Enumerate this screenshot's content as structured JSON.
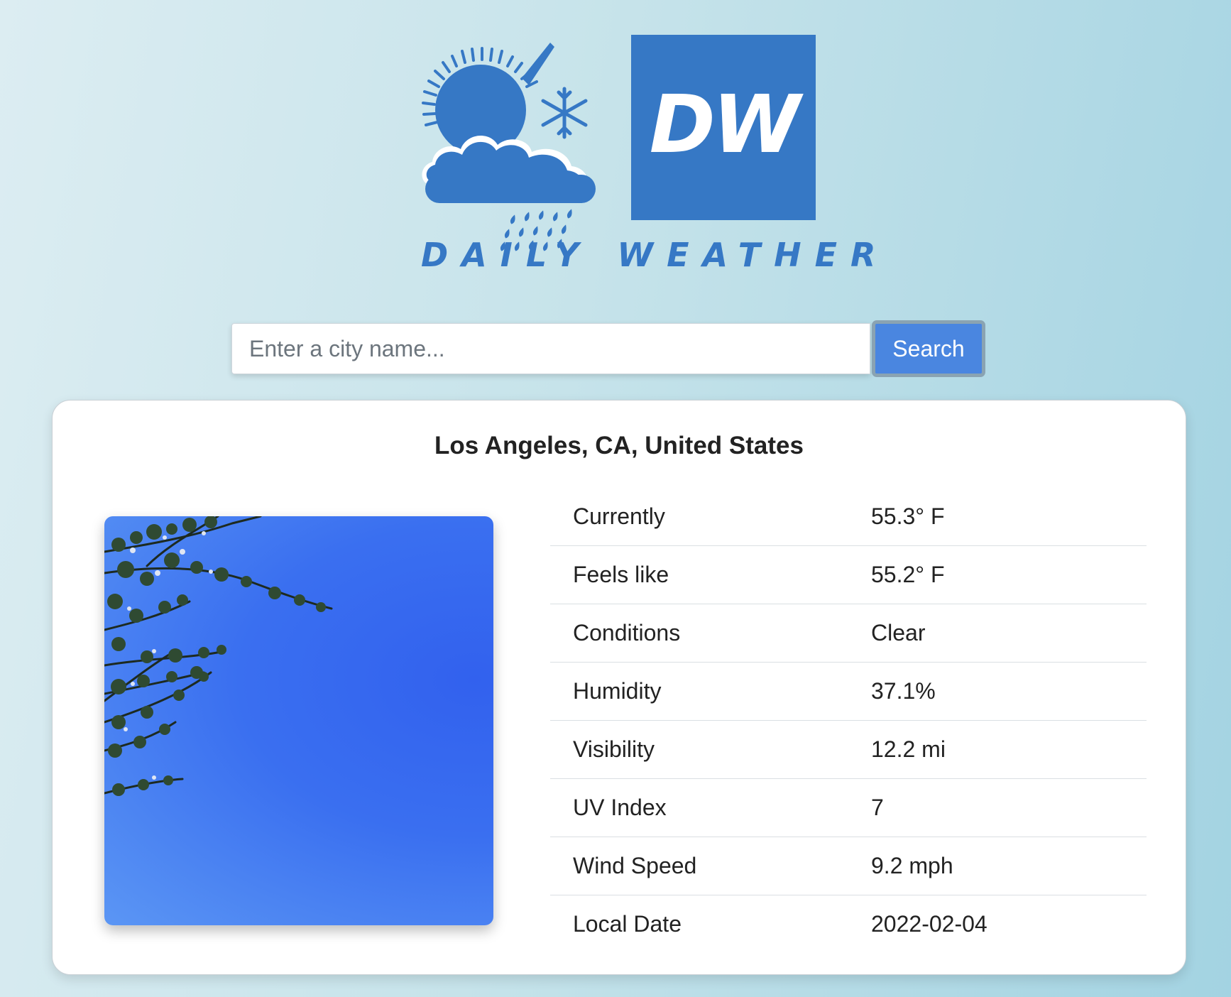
{
  "brand": {
    "monogram": "DW",
    "name": "DAILY WEATHER"
  },
  "search": {
    "placeholder": "Enter a city name...",
    "value": "",
    "button_label": "Search"
  },
  "weather": {
    "location": "Los Angeles, CA, United States",
    "rows": [
      {
        "label": "Currently",
        "value": "55.3° F"
      },
      {
        "label": "Feels like",
        "value": "55.2° F"
      },
      {
        "label": "Conditions",
        "value": "Clear"
      },
      {
        "label": "Humidity",
        "value": "37.1%"
      },
      {
        "label": "Visibility",
        "value": "12.2 mi"
      },
      {
        "label": "UV Index",
        "value": "7"
      },
      {
        "label": "Wind Speed",
        "value": "9.2 mph"
      },
      {
        "label": "Local Date",
        "value": "2022-02-04"
      }
    ]
  },
  "colors": {
    "brand_blue": "#3678c5",
    "button_blue": "#4a86e0",
    "sky_blue": "#3a6ff0"
  },
  "icons": {
    "logo_symbol": "sun-cloud-snow-rain-icon"
  }
}
